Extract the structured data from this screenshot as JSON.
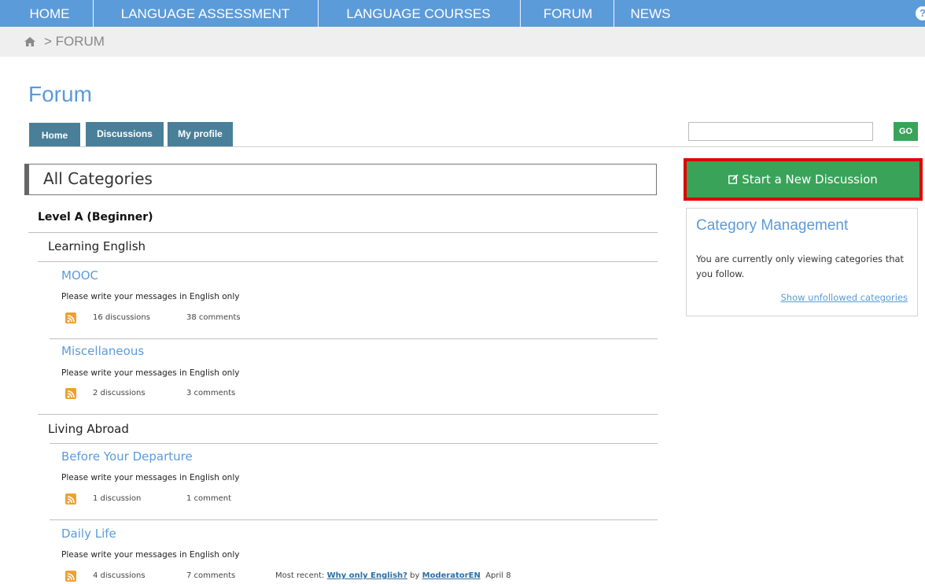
{
  "nav": {
    "items": [
      "HOME",
      "LANGUAGE ASSESSMENT",
      "LANGUAGE COURSES",
      "FORUM",
      "NEWS"
    ],
    "help": "?"
  },
  "breadcrumb": {
    "text": "> FORUM"
  },
  "page": {
    "title": "Forum"
  },
  "tabs": [
    "Home",
    "Discussions",
    "My profile"
  ],
  "search": {
    "value": "",
    "go_label": "GO"
  },
  "section": {
    "title": "All Categories"
  },
  "level": {
    "title": "Level A (Beginner)"
  },
  "subcategories": [
    "Learning English",
    "Living Abroad"
  ],
  "categories": [
    {
      "title": "MOOC",
      "desc": "Please write your messages in English only",
      "discussions": "16 discussions",
      "comments": "38 comments"
    },
    {
      "title": "Miscellaneous",
      "desc": "Please write your messages in English only",
      "discussions": "2 discussions",
      "comments": "3 comments"
    },
    {
      "title": "Before Your Departure",
      "desc": "Please write your messages in English only",
      "discussions": "1 discussion",
      "comments": "1 comment"
    },
    {
      "title": "Daily Life",
      "desc": "Please write your messages in English only",
      "discussions": "4 discussions",
      "comments": "7 comments",
      "recent": {
        "prefix": "Most recent:",
        "title": "Why only English?",
        "by": "by",
        "author": "ModeratorEN",
        "date": "April 8"
      }
    }
  ],
  "sidebar": {
    "start_button": "Start a New Discussion",
    "management": {
      "title": "Category Management",
      "text": "You are currently only viewing categories that you follow.",
      "link": "Show unfollowed categories"
    }
  },
  "colors": {
    "nav": "#5b9bd9",
    "tabs": "#4a7f99",
    "green": "#3aa35a",
    "highlight": "#e00000",
    "rss": "#f0a030"
  }
}
